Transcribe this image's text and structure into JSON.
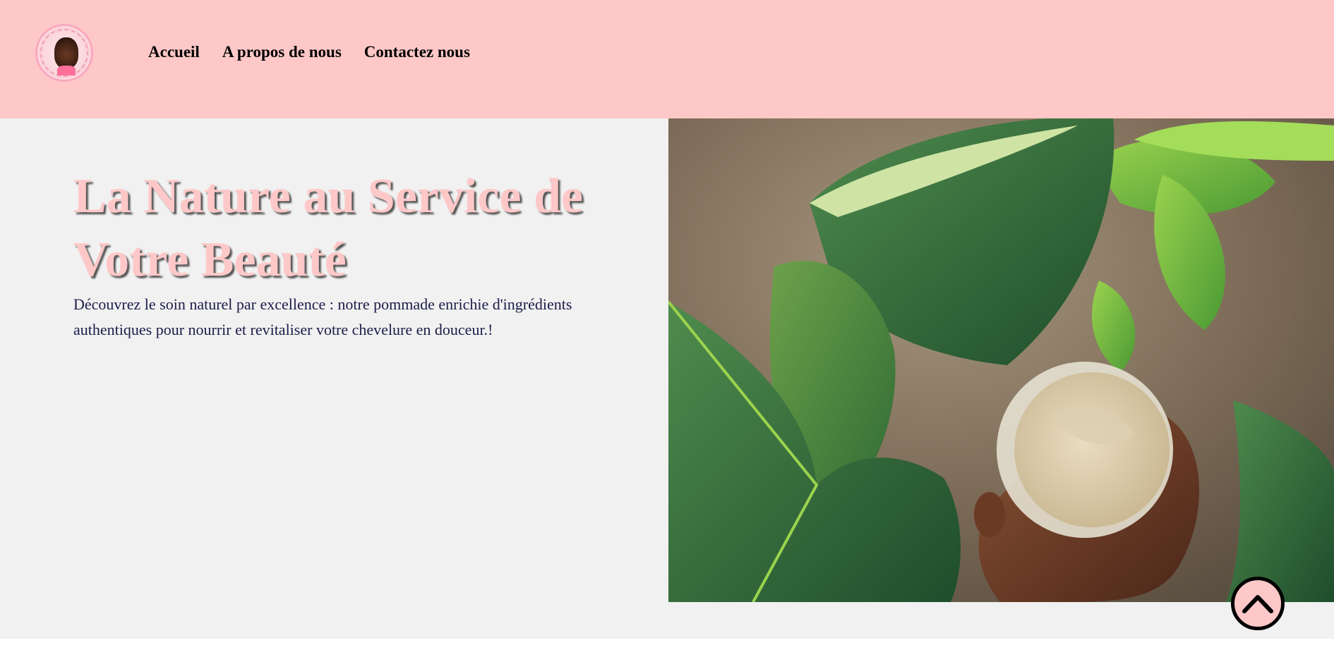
{
  "header": {
    "logo_alt": "logo",
    "nav": [
      {
        "label": "Accueil"
      },
      {
        "label": "A propos de nous"
      },
      {
        "label": "Contactez nous"
      }
    ]
  },
  "hero": {
    "title": "La Nature au Service de Votre Beauté",
    "description": "Découvrez le soin naturel par excellence : notre pommade enrichie d'ingrédients authentiques pour nourrir et revitaliser votre chevelure en douceur.!",
    "image_subject": "hand-holding-hair-cream-jar-among-leaves"
  },
  "scroll_to_top": {
    "icon": "chevron-up-icon"
  },
  "colors": {
    "header_bg": "#ffc8c8",
    "hero_bg": "#f1f1f1",
    "title_color": "#ffc8c8",
    "text_color": "#1c1c4a"
  }
}
